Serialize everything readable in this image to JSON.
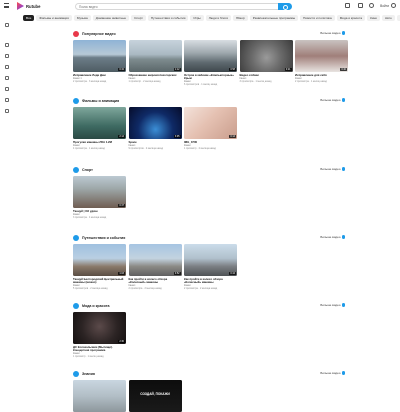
{
  "header": {
    "logo_text": "Rutube",
    "search_placeholder": "Поиск видео",
    "create_label": "",
    "login_label": "Войти"
  },
  "categories": [
    "Все",
    "Фильмы и анимация",
    "Музыка",
    "Домашние животные",
    "Спорт",
    "Путешествия и события",
    "Игры",
    "Люди и блоги",
    "Юмор",
    "Развлекательные программы",
    "Новости и политика",
    "Мода и красота",
    "Кино",
    "Авто",
    "Наука",
    "Хобби",
    "Образование",
    "Еда",
    "Техника"
  ],
  "sections": [
    {
      "title": "Популярное видео",
      "color": "#e8394a",
      "more": "Больше видео",
      "cards": [
        {
          "title": "Исправление Леди Джи",
          "channel": "Канал 1",
          "meta": "2 просмотра · 3 месяца назад",
          "duration": "0:32",
          "bg": "linear-gradient(180deg,#8fb3d6 0%,#b7c9d6 45%,#6c7d88 55%,#4e5c63 100%)"
        },
        {
          "title": "Образование широкоглазогорских",
          "channel": "Канал",
          "meta": "1 просмотр · 2 месяца назад",
          "duration": "1:12",
          "bg": "linear-gradient(180deg,#c7d3dc 0%,#aab9c3 45%,#7e8c8f 60%,#5a6669 100%)"
        },
        {
          "title": "Остров в кабинке «Компьютерные» Крым",
          "channel": "Канал",
          "meta": "6 просмотров · 1 месяц назад",
          "duration": "0:58",
          "bg": "linear-gradient(180deg,#d8dde2 0%,#9fa9ae 40%,#5f6a70 70%,#3e474c 100%)"
        },
        {
          "title": "Видео собаки",
          "channel": "Канал",
          "meta": "3 просмотра · 1 месяц назад",
          "duration": "0:21",
          "bg": "radial-gradient(circle at 50% 55%,#9a9a9a 0%,#6b6b6b 45%,#3a3a3a 100%)"
        },
        {
          "title": "Исправление для себя",
          "channel": "Канал",
          "meta": "2 просмотра · 1 месяц назад",
          "duration": "0:40",
          "bg": "linear-gradient(180deg,#c9c3c1 0%,#a07f7a 50%,#e8e4e1 100%)"
        }
      ]
    },
    {
      "title": "Фильмы и анимация",
      "color": "#1e9be9",
      "more": "Больше видео",
      "cards": [
        {
          "title": "Прогулки машины ZDA 1.2M",
          "channel": "Канал",
          "meta": "4 просмотра · 1 месяц назад",
          "duration": "2:14",
          "bg": "linear-gradient(180deg,#7fa79c 0%,#3e6a62 60%,#2b4944 100%)"
        },
        {
          "title": "Space",
          "channel": "Канал",
          "meta": "9 просмотров · 2 месяца назад",
          "duration": "3:05",
          "bg": "radial-gradient(circle at 50% 70%,#3b8ed6 0%,#0f2a66 50%,#060c2a 100%)"
        },
        {
          "title": "IMG_3700",
          "channel": "Канал",
          "meta": "1 просмотр · 2 месяца назад",
          "duration": "0:14",
          "bg": "linear-gradient(135deg,#f3e2da 0%,#e5c1b2 45%,#c99d8c 100%)"
        }
      ]
    },
    {
      "title": "Спорт",
      "color": "#1e9be9",
      "more": "Больше видео",
      "cards": [
        {
          "title": "Танцуй | Об удаче",
          "channel": "Канал",
          "meta": "3 просмотра · 4 месяца назад",
          "duration": "0:47",
          "bg": "linear-gradient(180deg,#bcc9d2 0%,#9da7a8 40%,#6f5d52 100%)"
        }
      ]
    },
    {
      "title": "Путешествия и события",
      "color": "#1e9be9",
      "more": "Больше видео",
      "cards": [
        {
          "title": "Танцуй Белгородский Центральный машины (можно)",
          "channel": "Канал",
          "meta": "5 просмотров · 2 месяца назад",
          "duration": "1:03",
          "bg": "linear-gradient(180deg,#9fc0e0 0%,#b9cfe2 45%,#8b7a6b 70%,#5b4e44 100%)"
        },
        {
          "title": "Как пройти в колесо обзора «Колесный» машины",
          "channel": "Канал",
          "meta": "2 просмотра · 2 месяца назад",
          "duration": "0:52",
          "bg": "linear-gradient(180deg,#a6c4e2 0%,#c3d3e0 45%,#8b8a85 70%,#606060 100%)"
        },
        {
          "title": "Как пройти в колесо обзора «Колесный» машины",
          "channel": "Канал",
          "meta": "2 просмотра · 2 месяца назад",
          "duration": "0:44",
          "bg": "linear-gradient(180deg,#cbdcea 0%,#b0c0cc 45%,#7b7f83 70%,#4f5356 100%)"
        }
      ]
    },
    {
      "title": "Мода и красота",
      "color": "#1e9be9",
      "more": "Больше видео",
      "cards": [
        {
          "title": "ДС Колокольчики (Мытищи). Концертная программа",
          "channel": "Канал",
          "meta": "1 просмотр · 1 месяц назад",
          "duration": "2:30",
          "bg": "radial-gradient(circle at 50% 45%,#5b4a4a 0%,#2c2424 55%,#141010 100%)"
        }
      ]
    },
    {
      "title": "Знания",
      "color": "#1e9be9",
      "more": "Больше видео",
      "cards": [
        {
          "title": "",
          "channel": "",
          "meta": "",
          "duration": "",
          "bg": "linear-gradient(180deg,#c9d6e0 0%,#b2bec6 50%,#8d979c 100%)"
        },
        {
          "title": "",
          "channel": "",
          "meta": "",
          "duration": "",
          "bg": "linear-gradient(180deg,#0d0d0d 0%,#1a1a1a 100%)",
          "overlay": "СОЗДАЙ, ПОКАЖИ"
        }
      ]
    }
  ]
}
